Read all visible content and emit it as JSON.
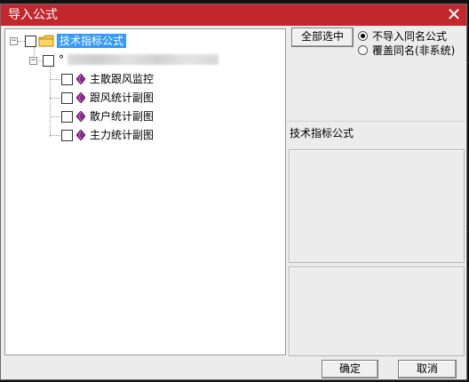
{
  "window": {
    "title": "导入公式",
    "close_glyph": "✕"
  },
  "tree": {
    "root": {
      "label": "技术指标公式",
      "expander": "−",
      "icon": "folder-icon"
    },
    "child": {
      "label": "°",
      "expander": "−"
    },
    "items": [
      {
        "label": "主散跟风监控",
        "icon": "gem-icon"
      },
      {
        "label": "跟风统计副图",
        "icon": "gem-icon"
      },
      {
        "label": "散户统计副图",
        "icon": "gem-icon"
      },
      {
        "label": "主力统计副图",
        "icon": "gem-icon"
      }
    ]
  },
  "options": {
    "select_all_label": "全部选中",
    "radio_no_import": "不导入同名公式",
    "radio_overwrite": "覆盖同名(非系统)",
    "selected": "no_import"
  },
  "description_label": "技术指标公式",
  "footer": {
    "ok_label": "确定",
    "cancel_label": "取消"
  },
  "colors": {
    "titlebar": "#c1272d",
    "selection": "#3399ff",
    "gem": "#8e2b8e"
  }
}
